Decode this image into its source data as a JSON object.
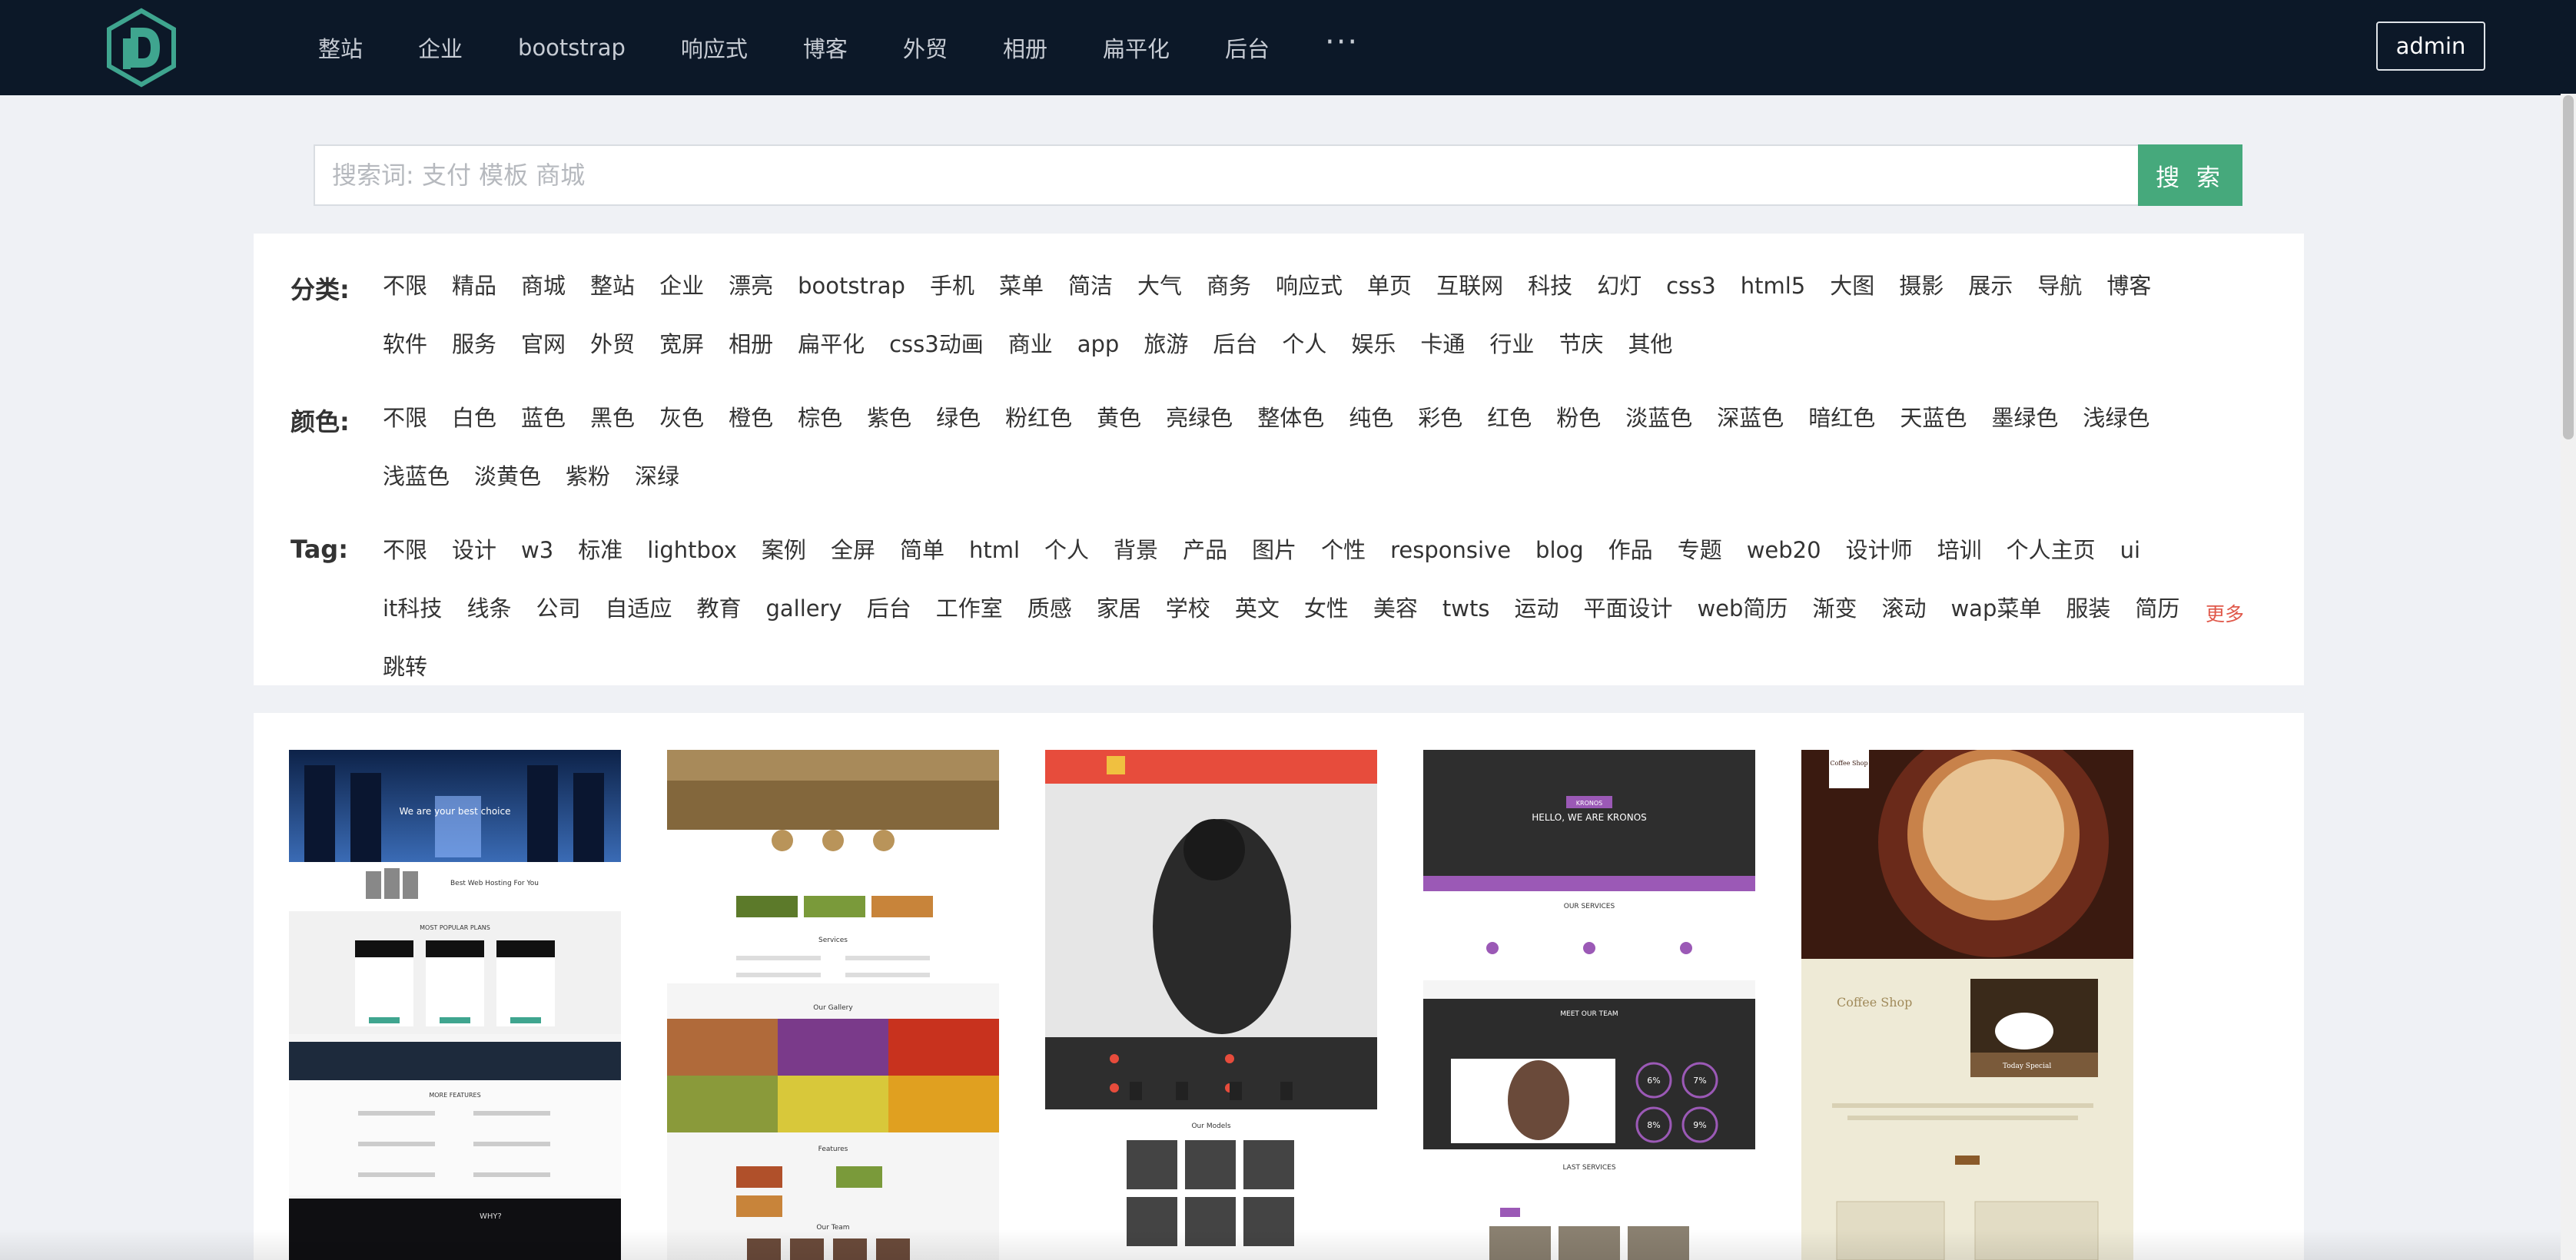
{
  "nav": {
    "items": [
      "整站",
      "企业",
      "bootstrap",
      "响应式",
      "博客",
      "外贸",
      "相册",
      "扁平化",
      "后台"
    ],
    "more": "···",
    "admin": "admin"
  },
  "search": {
    "placeholder": "搜索词: 支付 模板 商城",
    "button": "搜 索"
  },
  "filters": {
    "category": {
      "label": "分类:",
      "items": [
        "不限",
        "精品",
        "商城",
        "整站",
        "企业",
        "漂亮",
        "bootstrap",
        "手机",
        "菜单",
        "简洁",
        "大气",
        "商务",
        "响应式",
        "单页",
        "互联网",
        "科技",
        "幻灯",
        "css3",
        "html5",
        "大图",
        "摄影",
        "展示",
        "导航",
        "博客",
        "软件",
        "服务",
        "官网",
        "外贸",
        "宽屏",
        "相册",
        "扁平化",
        "css3动画",
        "商业",
        "app",
        "旅游",
        "后台",
        "个人",
        "娱乐",
        "卡通",
        "行业",
        "节庆",
        "其他"
      ]
    },
    "color": {
      "label": "颜色:",
      "items": [
        "不限",
        "白色",
        "蓝色",
        "黑色",
        "灰色",
        "橙色",
        "棕色",
        "紫色",
        "绿色",
        "粉红色",
        "黄色",
        "亮绿色",
        "整体色",
        "纯色",
        "彩色",
        "红色",
        "粉色",
        "淡蓝色",
        "深蓝色",
        "暗红色",
        "天蓝色",
        "墨绿色",
        "浅绿色",
        "浅蓝色",
        "淡黄色",
        "紫粉",
        "深绿"
      ]
    },
    "tag": {
      "label": "Tag:",
      "items": [
        "不限",
        "设计",
        "w3",
        "标准",
        "lightbox",
        "案例",
        "全屏",
        "简单",
        "html",
        "个人",
        "背景",
        "产品",
        "图片",
        "个性",
        "responsive",
        "blog",
        "作品",
        "专题",
        "web20",
        "设计师",
        "培训",
        "个人主页",
        "ui",
        "it科技",
        "线条",
        "公司",
        "自适应",
        "教育",
        "gallery",
        "后台",
        "工作室",
        "质感",
        "家居",
        "学校",
        "英文",
        "女性",
        "美容",
        "twts",
        "运动",
        "平面设计",
        "web简历",
        "渐变",
        "滚动",
        "wap菜单",
        "服装",
        "简历",
        "跳转"
      ]
    },
    "more": "更多"
  },
  "templates": [
    {
      "name": "hosting-template",
      "hero_text": "We are your best choice",
      "section": "Best Web Hosting For You",
      "plans": "MOST POPULAR PLANS",
      "features": "MORE FEATURES",
      "why": "WHY?"
    },
    {
      "name": "farm-template",
      "services": "Services",
      "gallery": "Our Gallery",
      "features": "Features",
      "team": "Our Team"
    },
    {
      "name": "portrait-template",
      "section": "Our Models"
    },
    {
      "name": "kronos-template",
      "badge": "KRONOS",
      "hero": "HELLO, WE ARE KRONOS",
      "services": "OUR SERVICES",
      "team": "MEET OUR TEAM",
      "last": "LAST SERVICES",
      "stats": [
        "6%",
        "7%",
        "8%",
        "9%"
      ]
    },
    {
      "name": "coffee-template",
      "logo": "Coffee Shop",
      "title": "Coffee Shop",
      "special": "Today Special"
    }
  ],
  "colors": {
    "header_bg": "#0c1828",
    "accent_green": "#46a97c",
    "more_red": "#e0584a"
  }
}
